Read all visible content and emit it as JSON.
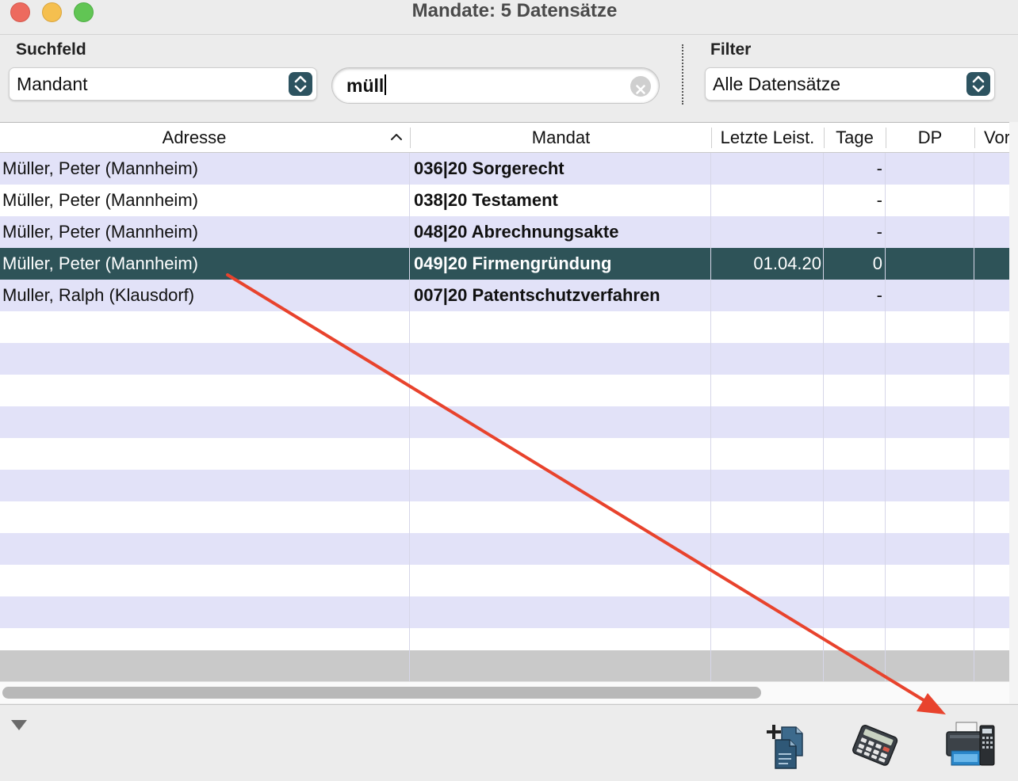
{
  "window": {
    "title": "Mandate: 5 Datensätze"
  },
  "search": {
    "field_label": "Suchfeld",
    "field_value": "Mandant",
    "query": "müll",
    "filter_label": "Filter",
    "filter_value": "Alle Datensätze"
  },
  "table": {
    "columns": [
      "Adresse",
      "Mandat",
      "Letzte Leist.",
      "Tage",
      "DP",
      "Vor"
    ],
    "sort_column": "Adresse",
    "sort_direction": "ascending",
    "rows": [
      {
        "adresse": "Müller, Peter (Mannheim)",
        "mandat": "036|20 Sorgerecht",
        "letzte": "",
        "tage": "-",
        "dp": "",
        "vor": ""
      },
      {
        "adresse": "Müller, Peter (Mannheim)",
        "mandat": "038|20 Testament",
        "letzte": "",
        "tage": "-",
        "dp": "",
        "vor": ""
      },
      {
        "adresse": "Müller, Peter (Mannheim)",
        "mandat": "048|20 Abrechnungsakte",
        "letzte": "",
        "tage": "-",
        "dp": "",
        "vor": ""
      },
      {
        "adresse": "Müller, Peter (Mannheim)",
        "mandat": "049|20 Firmengründung",
        "letzte": "01.04.20",
        "tage": "0",
        "dp": "",
        "vor": ""
      },
      {
        "adresse": "Muller, Ralph (Klausdorf)",
        "mandat": "007|20 Patentschutzverfahren",
        "letzte": "",
        "tage": "-",
        "dp": "",
        "vor": ""
      }
    ],
    "selected_row": 3
  },
  "toolbar": {
    "icons": [
      "new-document-icon",
      "calculator-icon",
      "printer-icon"
    ]
  },
  "colors": {
    "selection": "#2e5358",
    "row_stripe": "#e2e2f8",
    "accent_stepper": "#2d5360",
    "annotation_arrow": "#e8432d"
  }
}
